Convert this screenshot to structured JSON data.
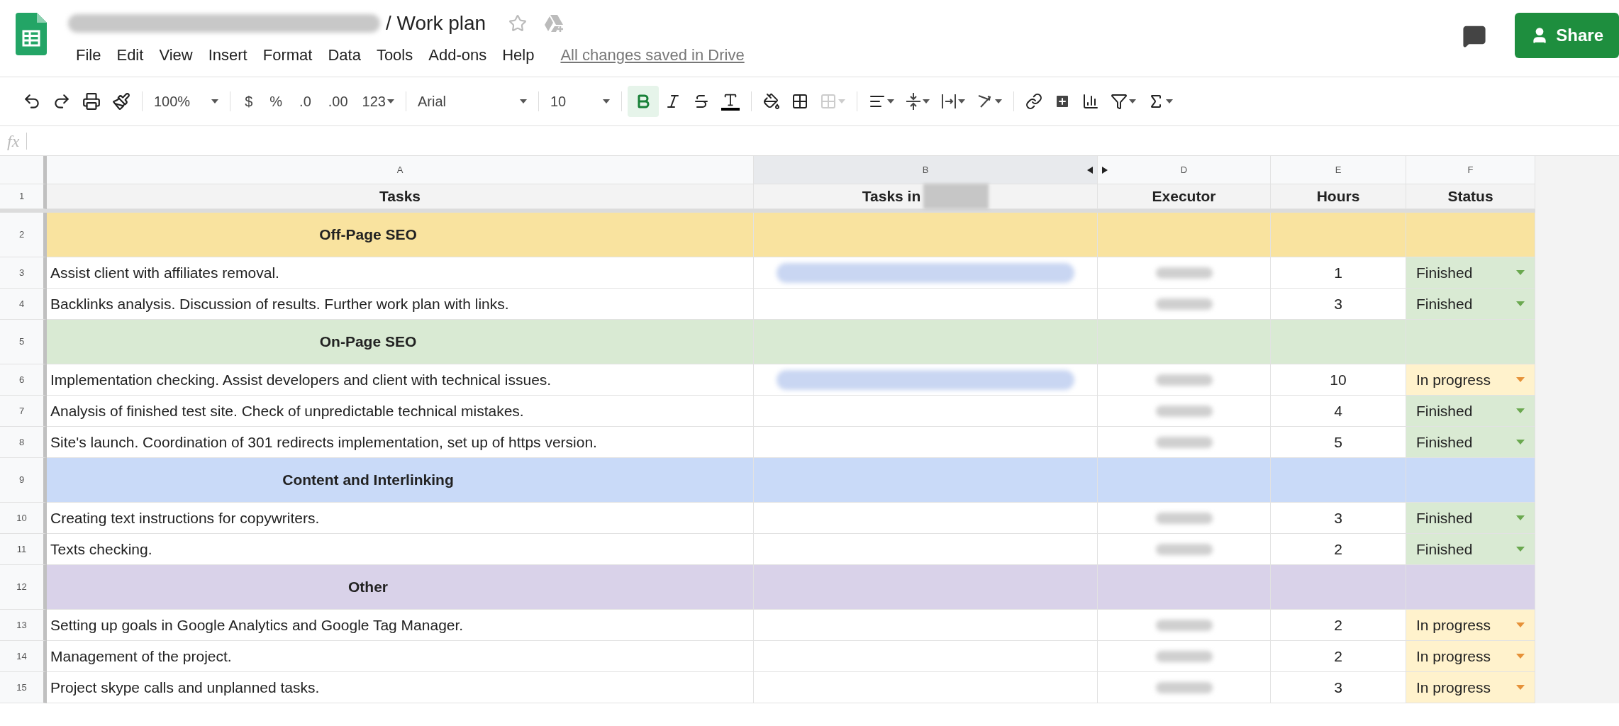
{
  "document": {
    "title": "/ Work plan",
    "title_prefix_redacted": true,
    "save_status": "All changes saved in Drive"
  },
  "menu": [
    "File",
    "Edit",
    "View",
    "Insert",
    "Format",
    "Data",
    "Tools",
    "Add-ons",
    "Help"
  ],
  "share_button": "Share",
  "toolbar": {
    "zoom": "100%",
    "currency": "$",
    "percent": "%",
    "decimal_less": ".0",
    "decimal_more": ".00",
    "format": "123",
    "font": "Arial",
    "font_size": "10",
    "bold_active": true
  },
  "formula_bar": {
    "label": "fx"
  },
  "columns": [
    {
      "letter": "A"
    },
    {
      "letter": "B"
    },
    {
      "letter": "D"
    },
    {
      "letter": "E"
    },
    {
      "letter": "F"
    }
  ],
  "header": {
    "number": "1",
    "tasks": "Tasks",
    "tasks_in": "Tasks in",
    "tasks_in_redacted": true,
    "executor": "Executor",
    "hours": "Hours",
    "status": "Status"
  },
  "rows": [
    {
      "kind": "section",
      "number": "2",
      "label": "Off-Page SEO",
      "color": "#f9e39f"
    },
    {
      "kind": "task",
      "number": "3",
      "task": "Assist client with affiliates removal.",
      "link_redacted": true,
      "executor_redacted": true,
      "hours": "1",
      "status": {
        "label": "Finished",
        "color": "#d9ead3"
      }
    },
    {
      "kind": "task",
      "number": "4",
      "task": "Backlinks analysis. Discussion of results. Further work plan with links.",
      "link_redacted": false,
      "executor_redacted": true,
      "hours": "3",
      "status": {
        "label": "Finished",
        "color": "#d9ead3"
      }
    },
    {
      "kind": "section",
      "number": "5",
      "label": "On-Page SEO",
      "color": "#d9ead3"
    },
    {
      "kind": "task",
      "number": "6",
      "task": "Implementation checking. Assist developers and client with technical issues.",
      "link_redacted": true,
      "executor_redacted": true,
      "hours": "10",
      "status": {
        "label": "In progress",
        "color": "#fff2cc"
      }
    },
    {
      "kind": "task",
      "number": "7",
      "task": "Analysis of finished test site. Check of unpredictable technical mistakes.",
      "link_redacted": false,
      "executor_redacted": true,
      "hours": "4",
      "status": {
        "label": "Finished",
        "color": "#d9ead3"
      }
    },
    {
      "kind": "task",
      "number": "8",
      "task": "Site's launch. Coordination of 301 redirects implementation, set up of https version.",
      "link_redacted": false,
      "executor_redacted": true,
      "hours": "5",
      "status": {
        "label": "Finished",
        "color": "#d9ead3"
      }
    },
    {
      "kind": "section",
      "number": "9",
      "label": "Content and Interlinking",
      "color": "#c9daf8"
    },
    {
      "kind": "task",
      "number": "10",
      "task": "Creating text instructions for copywriters.",
      "link_redacted": false,
      "executor_redacted": true,
      "hours": "3",
      "status": {
        "label": "Finished",
        "color": "#d9ead3"
      }
    },
    {
      "kind": "task",
      "number": "11",
      "task": "Texts checking.",
      "link_redacted": false,
      "executor_redacted": true,
      "hours": "2",
      "status": {
        "label": "Finished",
        "color": "#d9ead3"
      }
    },
    {
      "kind": "section",
      "number": "12",
      "label": "Other",
      "color": "#d9d2e9"
    },
    {
      "kind": "task",
      "number": "13",
      "task": "Setting up goals in Google Analytics and Google Tag Manager.",
      "link_redacted": false,
      "executor_redacted": true,
      "hours": "2",
      "status": {
        "label": "In progress",
        "color": "#fff2cc"
      }
    },
    {
      "kind": "task",
      "number": "14",
      "task": "Management of the project.",
      "link_redacted": false,
      "executor_redacted": true,
      "hours": "2",
      "status": {
        "label": "In progress",
        "color": "#fff2cc"
      }
    },
    {
      "kind": "task",
      "number": "15",
      "task": "Project skype calls and unplanned tasks.",
      "link_redacted": false,
      "executor_redacted": true,
      "hours": "3",
      "status": {
        "label": "In progress",
        "color": "#fff2cc"
      }
    }
  ]
}
